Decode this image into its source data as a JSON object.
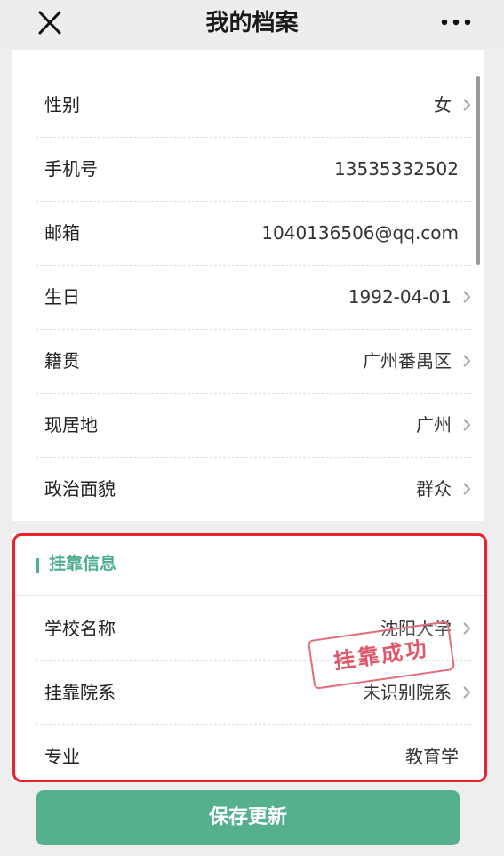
{
  "header": {
    "title": "我的档案",
    "close_icon": "close-icon",
    "more_icon": "more-icon"
  },
  "profile": {
    "rows": [
      {
        "label": "性别",
        "value": "女",
        "chevron": true
      },
      {
        "label": "手机号",
        "value": "13535332502",
        "chevron": false
      },
      {
        "label": "邮箱",
        "value": "1040136506@qq.com",
        "chevron": false
      },
      {
        "label": "生日",
        "value": "1992-04-01",
        "chevron": true
      },
      {
        "label": "籍贯",
        "value": "广州番禺区",
        "chevron": true
      },
      {
        "label": "现居地",
        "value": "广州",
        "chevron": true
      },
      {
        "label": "政治面貌",
        "value": "群众",
        "chevron": true
      }
    ]
  },
  "affiliation": {
    "section_title": "挂靠信息",
    "rows": [
      {
        "label": "学校名称",
        "value": "沈阳大学",
        "chevron": true
      },
      {
        "label": "挂靠院系",
        "value": "未识别院系",
        "chevron": true
      },
      {
        "label": "专业",
        "value": "教育学",
        "chevron": false
      }
    ],
    "stamp_text": "挂靠成功"
  },
  "footer": {
    "save_label": "保存更新"
  },
  "colors": {
    "accent": "#55b08e",
    "highlight": "#e8232b",
    "stamp": "#e1566a"
  }
}
